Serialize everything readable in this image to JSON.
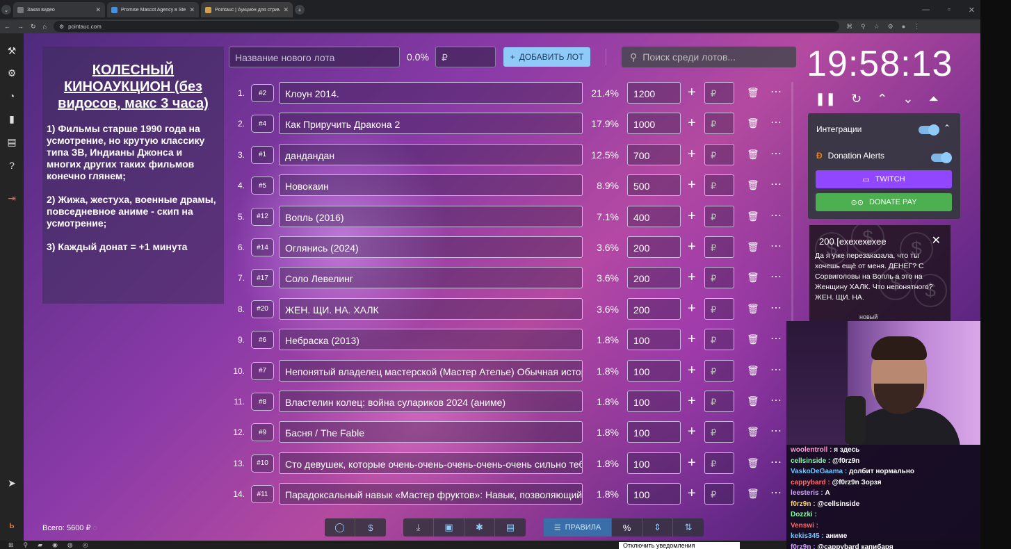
{
  "browser": {
    "tabs": [
      {
        "title": "Заказ видео"
      },
      {
        "title": "Promise Mascot Agency в Stea"
      },
      {
        "title": "Pointauc | Аукцион для стрим"
      }
    ],
    "url": "pointauc.com"
  },
  "rules": {
    "title": "КОЛЕСНЫЙ КИНОАУКЦИОН (без видосов, макс 3 часа)",
    "p1": "1) Фильмы старше 1990 года на усмотрение, но крутую классику типа ЗВ, Индианы Джонса и многих других таких фильмов конечно глянем;",
    "p2": "2) Жижа, жестуха, военные драмы, повседневное аниме - скип на усмотрение;",
    "p3": "3) Каждый донат = +1 минута"
  },
  "new_lot": {
    "name_placeholder": "Название нового лота",
    "percent": "0.0%",
    "amount_placeholder": "₽",
    "add_label": "ДОБАВИТЬ ЛОТ"
  },
  "search": {
    "placeholder": "Поиск среди лотов..."
  },
  "lots": [
    {
      "num": "1.",
      "id": "#2",
      "name": "Клоун 2014.",
      "percent": "21.4%",
      "amount": "1200"
    },
    {
      "num": "2.",
      "id": "#4",
      "name": "Как Приручить Дракона 2",
      "percent": "17.9%",
      "amount": "1000"
    },
    {
      "num": "3.",
      "id": "#1",
      "name": "дандандан",
      "percent": "12.5%",
      "amount": "700"
    },
    {
      "num": "4.",
      "id": "#5",
      "name": "Новокаин",
      "percent": "8.9%",
      "amount": "500"
    },
    {
      "num": "5.",
      "id": "#12",
      "name": "Вопль (2016)",
      "percent": "7.1%",
      "amount": "400"
    },
    {
      "num": "6.",
      "id": "#14",
      "name": "Оглянись (2024)",
      "percent": "3.6%",
      "amount": "200"
    },
    {
      "num": "7.",
      "id": "#17",
      "name": "Соло Левелинг",
      "percent": "3.6%",
      "amount": "200"
    },
    {
      "num": "8.",
      "id": "#20",
      "name": " ЖЕН. ЩИ. НА. ХАЛК",
      "percent": "3.6%",
      "amount": "200"
    },
    {
      "num": "9.",
      "id": "#6",
      "name": "Небраска (2013)",
      "percent": "1.8%",
      "amount": "100"
    },
    {
      "num": "10.",
      "id": "#7",
      "name": "Непонятый владелец мастерской (Мастер Ателье) Обычная истори",
      "percent": "1.8%",
      "amount": "100"
    },
    {
      "num": "11.",
      "id": "#8",
      "name": "Властелин колец: война сулариков 2024 (аниме)",
      "percent": "1.8%",
      "amount": "100"
    },
    {
      "num": "12.",
      "id": "#9",
      "name": "Басня / The Fable",
      "percent": "1.8%",
      "amount": "100"
    },
    {
      "num": "13.",
      "id": "#10",
      "name": "Сто девушек, которые очень-очень-очень-очень-очень сильно тебя л",
      "percent": "1.8%",
      "amount": "100"
    },
    {
      "num": "14.",
      "id": "#11",
      "name": "Парадоксальный навык «Мастер фруктов»: Навык, позволяющий ес",
      "percent": "1.8%",
      "amount": "100"
    }
  ],
  "row_add_placeholder": "₽",
  "total": "Всего: 5600 ₽",
  "bottom": {
    "rules_label": "ПРАВИЛА",
    "percent_symbol": "%",
    "dollar_symbol": "$"
  },
  "timer": "19:58:13",
  "integrations": {
    "title": "Интеграции",
    "donation_alerts": "Donation Alerts",
    "twitch": "TWITCH",
    "donate_pay": "DONATE PAY"
  },
  "donation": {
    "header": "200 [ехехехехее",
    "text": "Да я уже перезаказала, что ты хочешь ещё от меня. ДЕНЕГ? С Сорвиголовы на Вопль а это на Женщину ХАЛК. Что непонятного? ЖЕН. ЩИ. НА.",
    "badge": "новый"
  },
  "chat": [
    {
      "user": "woolentroll :",
      "msg": "я здесь"
    },
    {
      "user": "cellsinside :",
      "msg": "@f0rz9n"
    },
    {
      "user": "VaskoDeGaama :",
      "msg": "долбит нормально"
    },
    {
      "user": "cappybard :",
      "msg": "@f0rz9n Зорзя"
    },
    {
      "user": "leesteris :",
      "msg": "А"
    },
    {
      "user": "f0rz9n :",
      "msg": "@cellsinside"
    },
    {
      "user": "Dozzki :",
      "msg": ""
    },
    {
      "user": "Venswi :",
      "msg": ""
    },
    {
      "user": "kekis345 :",
      "msg": "аниме"
    },
    {
      "user": "f0rz9n :",
      "msg": "@cappybard капибаря"
    }
  ],
  "toast": "Отключить уведомления"
}
